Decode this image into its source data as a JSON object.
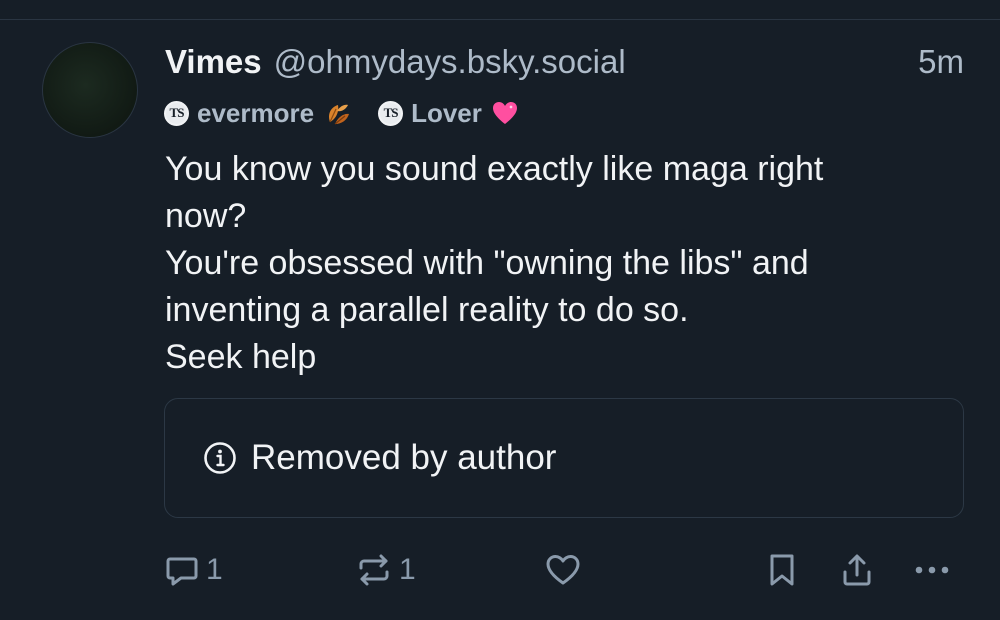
{
  "post": {
    "author": {
      "display_name": "Vimes",
      "handle": "@ohmydays.bsky.social"
    },
    "timestamp": "5m",
    "badges": [
      {
        "logo": "TS",
        "label": "evermore",
        "emoji": "autumn-leaves-icon"
      },
      {
        "logo": "TS",
        "label": "Lover",
        "emoji": "pink-heart-icon"
      }
    ],
    "text_lines": [
      "You know you sound exactly like maga right",
      "now?",
      "You're obsessed with \"owning the libs\" and",
      "inventing a parallel reality to do so.",
      "Seek help"
    ],
    "embed": {
      "icon": "info-icon",
      "text": "Removed by author"
    },
    "actions": {
      "reply_count": "1",
      "repost_count": "1"
    }
  },
  "colors": {
    "background": "#161e27",
    "primary_text": "#f1f3f5",
    "secondary_text": "#aebbc9",
    "icon_muted": "#8a9aab",
    "border": "#2c3845",
    "heart_emoji": "#ff4fa0",
    "leaf_emoji": "#d9822b"
  }
}
